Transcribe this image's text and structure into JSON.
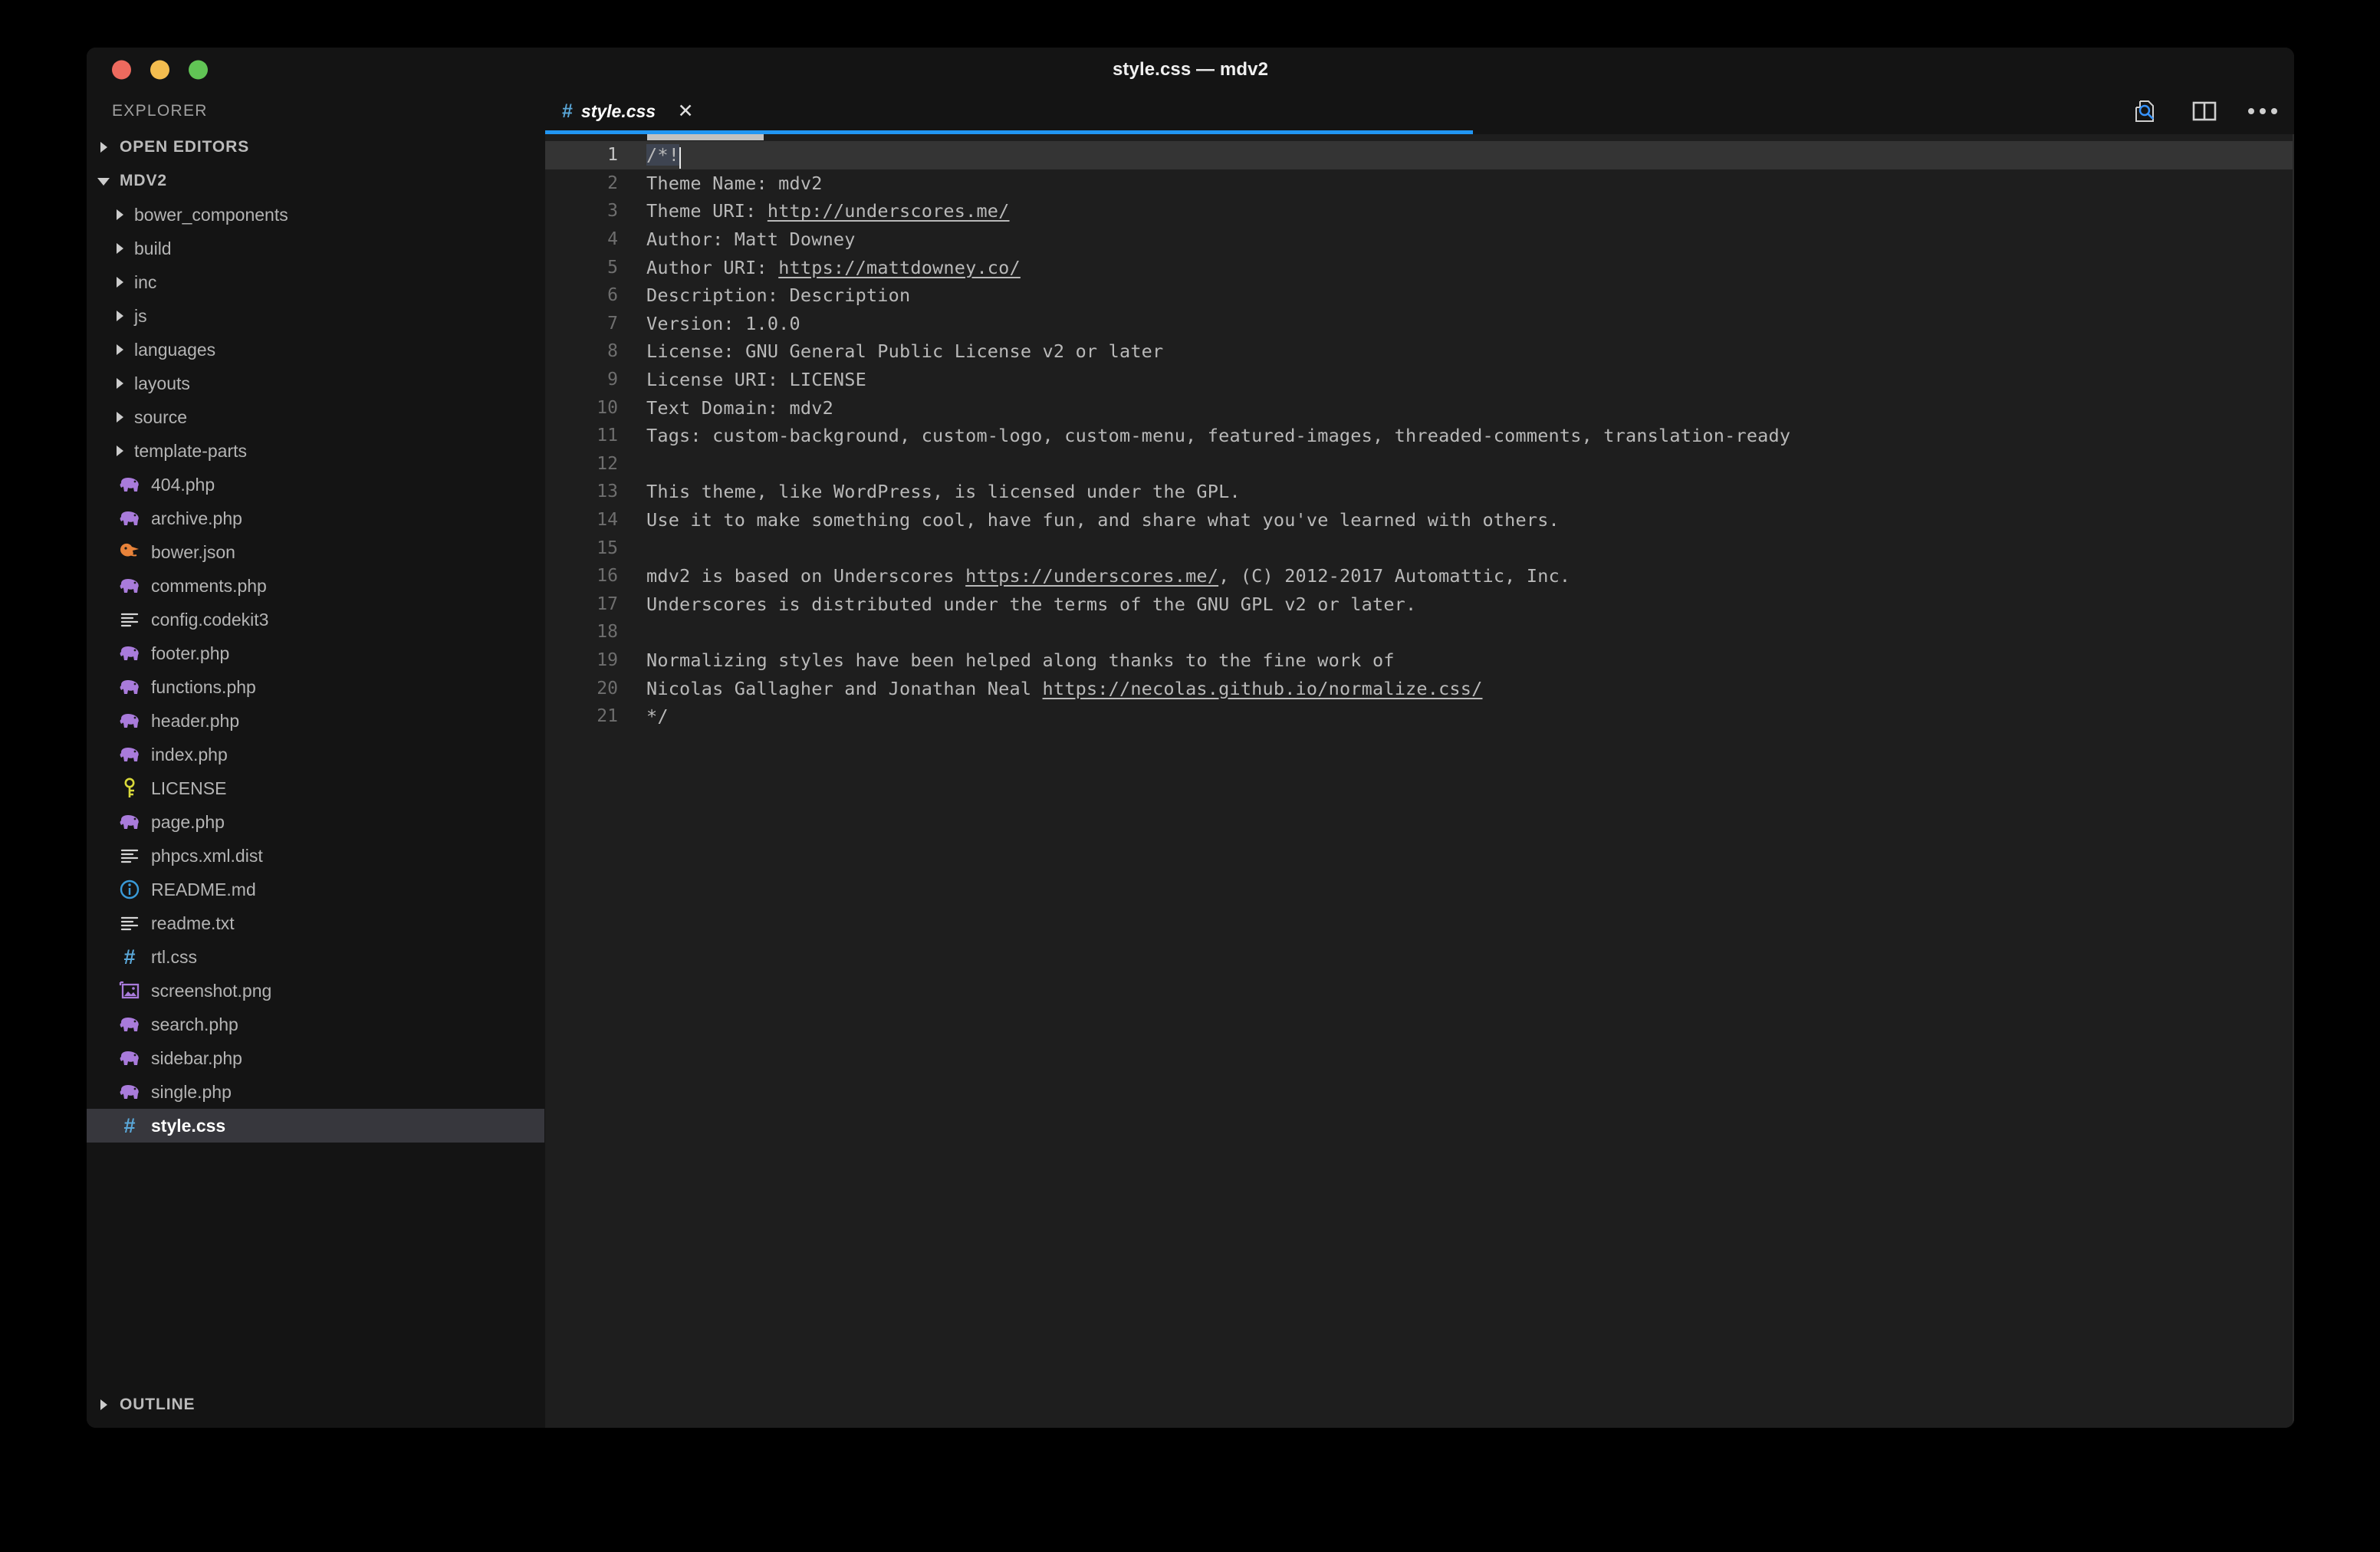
{
  "window": {
    "title": "style.css — mdv2",
    "traffic_lights": [
      {
        "name": "close",
        "color": "#ed6a5e"
      },
      {
        "name": "minimize",
        "color": "#f4bd4f"
      },
      {
        "name": "maximize",
        "color": "#61c555"
      }
    ]
  },
  "sidebar": {
    "title": "EXPLORER",
    "sections": [
      {
        "label": "OPEN EDITORS",
        "expanded": false
      },
      {
        "label": "MDV2",
        "expanded": true
      },
      {
        "label": "OUTLINE",
        "expanded": false
      }
    ],
    "tree": [
      {
        "name": "bower_components",
        "type": "folder"
      },
      {
        "name": "build",
        "type": "folder"
      },
      {
        "name": "inc",
        "type": "folder"
      },
      {
        "name": "js",
        "type": "folder"
      },
      {
        "name": "languages",
        "type": "folder"
      },
      {
        "name": "layouts",
        "type": "folder"
      },
      {
        "name": "source",
        "type": "folder"
      },
      {
        "name": "template-parts",
        "type": "folder"
      },
      {
        "name": "404.php",
        "type": "file",
        "icon": "php-elephant-icon"
      },
      {
        "name": "archive.php",
        "type": "file",
        "icon": "php-elephant-icon"
      },
      {
        "name": "bower.json",
        "type": "file",
        "icon": "bower-bird-icon"
      },
      {
        "name": "comments.php",
        "type": "file",
        "icon": "php-elephant-icon"
      },
      {
        "name": "config.codekit3",
        "type": "file",
        "icon": "text-lines-icon"
      },
      {
        "name": "footer.php",
        "type": "file",
        "icon": "php-elephant-icon"
      },
      {
        "name": "functions.php",
        "type": "file",
        "icon": "php-elephant-icon"
      },
      {
        "name": "header.php",
        "type": "file",
        "icon": "php-elephant-icon"
      },
      {
        "name": "index.php",
        "type": "file",
        "icon": "php-elephant-icon"
      },
      {
        "name": "LICENSE",
        "type": "file",
        "icon": "key-icon"
      },
      {
        "name": "page.php",
        "type": "file",
        "icon": "php-elephant-icon"
      },
      {
        "name": "phpcs.xml.dist",
        "type": "file",
        "icon": "text-lines-icon"
      },
      {
        "name": "README.md",
        "type": "file",
        "icon": "info-circle-icon"
      },
      {
        "name": "readme.txt",
        "type": "file",
        "icon": "text-lines-icon"
      },
      {
        "name": "rtl.css",
        "type": "file",
        "icon": "css-hash-icon"
      },
      {
        "name": "screenshot.png",
        "type": "file",
        "icon": "image-icon"
      },
      {
        "name": "search.php",
        "type": "file",
        "icon": "php-elephant-icon"
      },
      {
        "name": "sidebar.php",
        "type": "file",
        "icon": "php-elephant-icon"
      },
      {
        "name": "single.php",
        "type": "file",
        "icon": "php-elephant-icon"
      },
      {
        "name": "style.css",
        "type": "file",
        "icon": "css-hash-icon",
        "selected": true
      }
    ]
  },
  "editor": {
    "tabs": [
      {
        "label": "style.css",
        "icon": "css-hash-icon",
        "close_label": "✕",
        "active": true,
        "preview": true
      }
    ],
    "actions": [
      {
        "name": "open-preview-icon",
        "label": "Open Preview"
      },
      {
        "name": "split-editor-icon",
        "label": "Split Editor"
      },
      {
        "name": "more-actions-icon",
        "label": "More Actions..."
      }
    ],
    "accent_color": "#2196f3",
    "active_line": 1,
    "lines": [
      {
        "n": 1,
        "segments": [
          {
            "t": "/*!",
            "sel": true
          },
          {
            "caret": true
          }
        ]
      },
      {
        "n": 2,
        "segments": [
          {
            "t": "Theme Name: mdv2"
          }
        ]
      },
      {
        "n": 3,
        "segments": [
          {
            "t": "Theme URI: "
          },
          {
            "t": "http://underscores.me/",
            "link": true
          }
        ]
      },
      {
        "n": 4,
        "segments": [
          {
            "t": "Author: Matt Downey"
          }
        ]
      },
      {
        "n": 5,
        "segments": [
          {
            "t": "Author URI: "
          },
          {
            "t": "https://mattdowney.co/",
            "link": true
          }
        ]
      },
      {
        "n": 6,
        "segments": [
          {
            "t": "Description: Description"
          }
        ]
      },
      {
        "n": 7,
        "segments": [
          {
            "t": "Version: 1.0.0"
          }
        ]
      },
      {
        "n": 8,
        "segments": [
          {
            "t": "License: GNU General Public License v2 or later"
          }
        ]
      },
      {
        "n": 9,
        "segments": [
          {
            "t": "License URI: LICENSE"
          }
        ]
      },
      {
        "n": 10,
        "segments": [
          {
            "t": "Text Domain: mdv2"
          }
        ]
      },
      {
        "n": 11,
        "segments": [
          {
            "t": "Tags: custom-background, custom-logo, custom-menu, featured-images, threaded-comments, translation-ready"
          }
        ]
      },
      {
        "n": 12,
        "segments": [
          {
            "t": ""
          }
        ]
      },
      {
        "n": 13,
        "segments": [
          {
            "t": "This theme, like WordPress, is licensed under the GPL."
          }
        ]
      },
      {
        "n": 14,
        "segments": [
          {
            "t": "Use it to make something cool, have fun, and share what you've learned with others."
          }
        ]
      },
      {
        "n": 15,
        "segments": [
          {
            "t": ""
          }
        ]
      },
      {
        "n": 16,
        "segments": [
          {
            "t": "mdv2 is based on Underscores "
          },
          {
            "t": "https://underscores.me/",
            "link": true
          },
          {
            "t": ", (C) 2012-2017 Automattic, Inc."
          }
        ]
      },
      {
        "n": 17,
        "segments": [
          {
            "t": "Underscores is distributed under the terms of the GNU GPL v2 or later."
          }
        ]
      },
      {
        "n": 18,
        "segments": [
          {
            "t": ""
          }
        ]
      },
      {
        "n": 19,
        "segments": [
          {
            "t": "Normalizing styles have been helped along thanks to the fine work of"
          }
        ]
      },
      {
        "n": 20,
        "segments": [
          {
            "t": "Nicolas Gallagher and Jonathan Neal "
          },
          {
            "t": "https://necolas.github.io/normalize.css/",
            "link": true
          }
        ]
      },
      {
        "n": 21,
        "segments": [
          {
            "t": "*/"
          }
        ]
      }
    ]
  }
}
